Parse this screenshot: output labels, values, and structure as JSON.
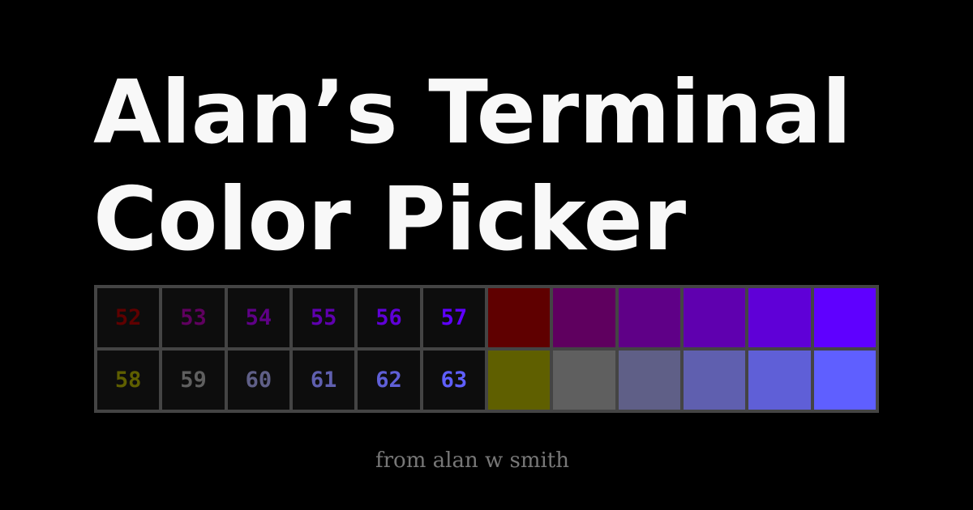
{
  "title": {
    "line1": "Alan’s Terminal",
    "line2": "Color Picker"
  },
  "byline": "from alan w smith",
  "palette": {
    "rows": [
      [
        {
          "number": "52",
          "color": "#5f0000"
        },
        {
          "number": "53",
          "color": "#5f005f"
        },
        {
          "number": "54",
          "color": "#5f0087"
        },
        {
          "number": "55",
          "color": "#5f00af"
        },
        {
          "number": "56",
          "color": "#5f00d7"
        },
        {
          "number": "57",
          "color": "#5f00ff"
        }
      ],
      [
        {
          "number": "58",
          "color": "#5f5f00"
        },
        {
          "number": "59",
          "color": "#5f5f5f"
        },
        {
          "number": "60",
          "color": "#5f5f87"
        },
        {
          "number": "61",
          "color": "#5f5faf"
        },
        {
          "number": "62",
          "color": "#5f5fd7"
        },
        {
          "number": "63",
          "color": "#5f5fff"
        }
      ]
    ]
  }
}
